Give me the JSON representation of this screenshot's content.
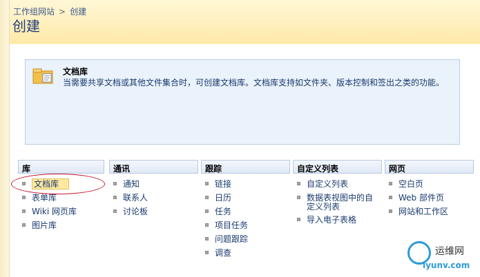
{
  "breadcrumb": {
    "root": "工作组网站",
    "separator": ">",
    "current": "创建"
  },
  "page_title": "创建",
  "description": {
    "title": "文档库",
    "text": "当需要共享文档或其他文件集合时，可创建文档库。文档库支持如文件夹、版本控制和签出之类的功能。",
    "icon": "document-library-icon"
  },
  "categories": [
    {
      "header": "库",
      "items": [
        "文档库",
        "表单库",
        "Wiki 网页库",
        "图片库"
      ]
    },
    {
      "header": "通讯",
      "items": [
        "通知",
        "联系人",
        "讨论板"
      ]
    },
    {
      "header": "跟踪",
      "items": [
        "链接",
        "日历",
        "任务",
        "项目任务",
        "问题跟踪",
        "调查"
      ]
    },
    {
      "header": "自定义列表",
      "items": [
        "自定义列表",
        "数据表视图中的自定义列表",
        "导入电子表格"
      ]
    },
    {
      "header": "网页",
      "items": [
        "空白页",
        "Web 部件页",
        "网站和工作区"
      ]
    }
  ],
  "selected_item": "文档库",
  "colors": {
    "accent": "#1f3d78",
    "link": "#1a3a6e",
    "highlight": "#ffe9a0",
    "annotation": "#c8142c"
  },
  "watermark": {
    "title": "运维网",
    "url": "iyunv.com"
  }
}
